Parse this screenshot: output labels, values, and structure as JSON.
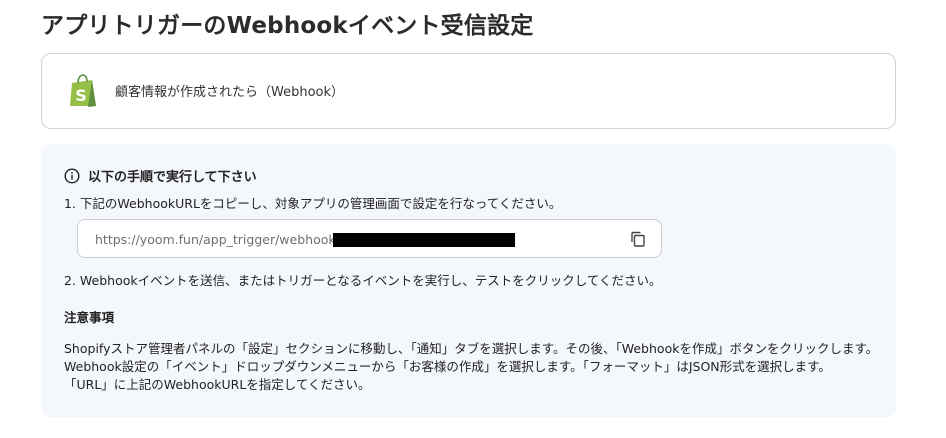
{
  "page": {
    "title": "アプリトリガーのWebhookイベント受信設定"
  },
  "app_card": {
    "icon": "shopify-bag-icon",
    "label": "顧客情報が作成されたら（Webhook）"
  },
  "instructions": {
    "heading": "以下の手順で実行して下さい",
    "heading_icon": "info-circle-icon",
    "step1": "1. 下記のWebhookURLをコピーし、対象アプリの管理画面で設定を行なってください。",
    "webhook_url": "https://yoom.fun/app_trigger/webhooks",
    "copy_icon": "copy-icon",
    "step2": "2. Webhookイベントを送信、またはトリガーとなるイベントを実行し、テストをクリックしてください。"
  },
  "notes": {
    "heading": "注意事項",
    "lines": [
      "Shopifyストア管理者パネルの「設定」セクションに移動し、「通知」タブを選択します。その後、「Webhookを作成」ボタンをクリックします。",
      "Webhook設定の「イベント」ドロップダウンメニューから「お客様の作成」を選択します。「フォーマット」はJSON形式を選択します。",
      "「URL」に上記のWebhookURLを指定してください。"
    ]
  },
  "colors": {
    "shopify_green": "#95bf47",
    "shopify_dark_green": "#5e8e3e",
    "panel_background": "#f4f7fb",
    "border": "#cfd2d6"
  }
}
